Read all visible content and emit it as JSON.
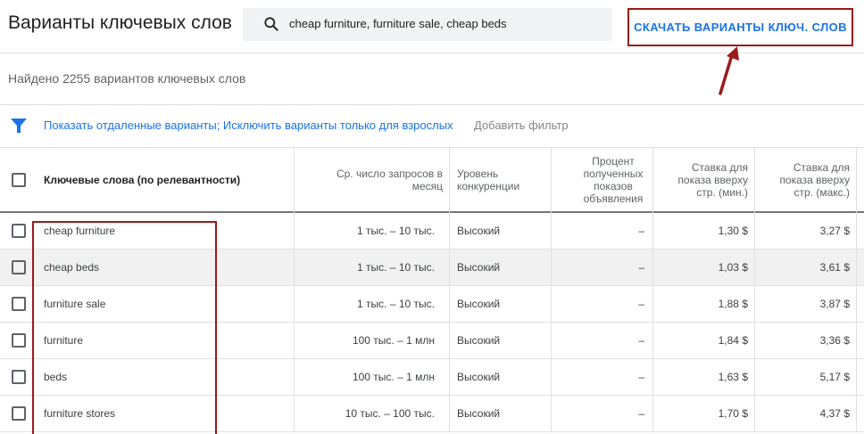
{
  "header": {
    "title": "Варианты ключевых слов",
    "search_value": "cheap furniture, furniture sale, cheap beds",
    "download_label": "СКАЧАТЬ ВАРИАНТЫ КЛЮЧ. СЛОВ"
  },
  "summary": {
    "found_text": "Найдено 2255 вариантов ключевых слов"
  },
  "filters": {
    "active_text": "Показать отдаленные варианты; Исключить варианты только для взрослых",
    "add_filter_label": "Добавить фильтр"
  },
  "table": {
    "headers": {
      "keyword": "Ключевые слова (по релевантности)",
      "searches": "Ср. число запросов в месяц",
      "competition": "Уровень конкуренции",
      "impression_share": "Процент полученных показов объявления",
      "bid_low": "Ставка для показа вверху стр. (мин.)",
      "bid_high": "Ставка для показа вверху стр. (макс.)"
    },
    "rows": [
      {
        "keyword": "cheap furniture",
        "searches": "1 тыс. – 10 тыс.",
        "competition": "Высокий",
        "impression_share": "–",
        "bid_low": "1,30 $",
        "bid_high": "3,27 $"
      },
      {
        "keyword": "cheap beds",
        "searches": "1 тыс. – 10 тыс.",
        "competition": "Высокий",
        "impression_share": "–",
        "bid_low": "1,03 $",
        "bid_high": "3,61 $"
      },
      {
        "keyword": "furniture sale",
        "searches": "1 тыс. – 10 тыс.",
        "competition": "Высокий",
        "impression_share": "–",
        "bid_low": "1,88 $",
        "bid_high": "3,87 $"
      },
      {
        "keyword": "furniture",
        "searches": "100 тыс. – 1 млн",
        "competition": "Высокий",
        "impression_share": "–",
        "bid_low": "1,84 $",
        "bid_high": "3,36 $"
      },
      {
        "keyword": "beds",
        "searches": "100 тыс. – 1 млн",
        "competition": "Высокий",
        "impression_share": "–",
        "bid_low": "1,63 $",
        "bid_high": "5,17 $"
      },
      {
        "keyword": "furniture stores",
        "searches": "10 тыс. – 100 тыс.",
        "competition": "Высокий",
        "impression_share": "–",
        "bid_low": "1,70 $",
        "bid_high": "4,37 $"
      }
    ]
  },
  "colors": {
    "accent": "#1a73e8",
    "annotation": "#9b1b1b",
    "row_alt": "#f1f1f1"
  },
  "icons": {
    "search": "search-icon",
    "filter": "filter-icon",
    "annotation_arrow": "annotation-arrow-icon"
  }
}
